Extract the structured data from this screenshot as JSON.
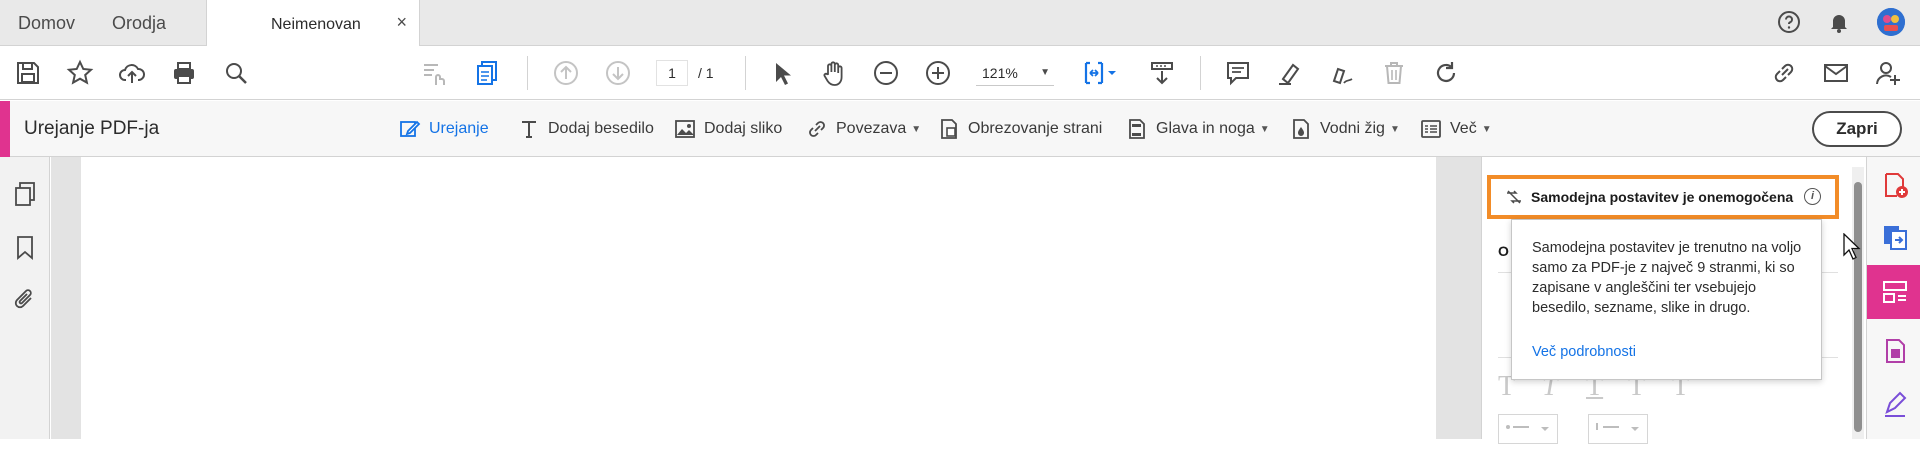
{
  "tabs": {
    "home": "Domov",
    "tools": "Orodja",
    "document": "Neimenovan",
    "close_symbol": "×"
  },
  "toolbar": {
    "page_current": "1",
    "page_total": "/ 1",
    "zoom": "121%"
  },
  "edit_bar": {
    "title": "Urejanje PDF-ja",
    "tools": [
      {
        "label": "Urejanje",
        "icon": "edit-icon",
        "active": true
      },
      {
        "label": "Dodaj besedilo",
        "icon": "text-icon"
      },
      {
        "label": "Dodaj sliko",
        "icon": "image-icon"
      },
      {
        "label": "Povezava",
        "icon": "link-icon",
        "dropdown": true
      },
      {
        "label": "Obrezovanje strani",
        "icon": "crop-icon"
      },
      {
        "label": "Glava in noga",
        "icon": "header-footer-icon",
        "dropdown": true
      },
      {
        "label": "Vodni žig",
        "icon": "watermark-icon",
        "dropdown": true
      },
      {
        "label": "Več",
        "icon": "more-icon",
        "dropdown": true
      }
    ],
    "close_label": "Zapri"
  },
  "right_panel": {
    "autotag_label": "Samodejna postavitev je onemogočena",
    "info_symbol": "i",
    "tooltip_body": "Samodejna postavitev je trenutno na voljo samo za PDF-je z največ 9 stranmi, ki so zapisane v angleščini ter vsebujejo besedilo, sezname, slike in drugo.",
    "tooltip_link": "Več podrobnosti",
    "hidden_letter": "O"
  },
  "colors": {
    "accent": "#e0338f",
    "link": "#1473e6",
    "highlight": "#f28c28"
  }
}
